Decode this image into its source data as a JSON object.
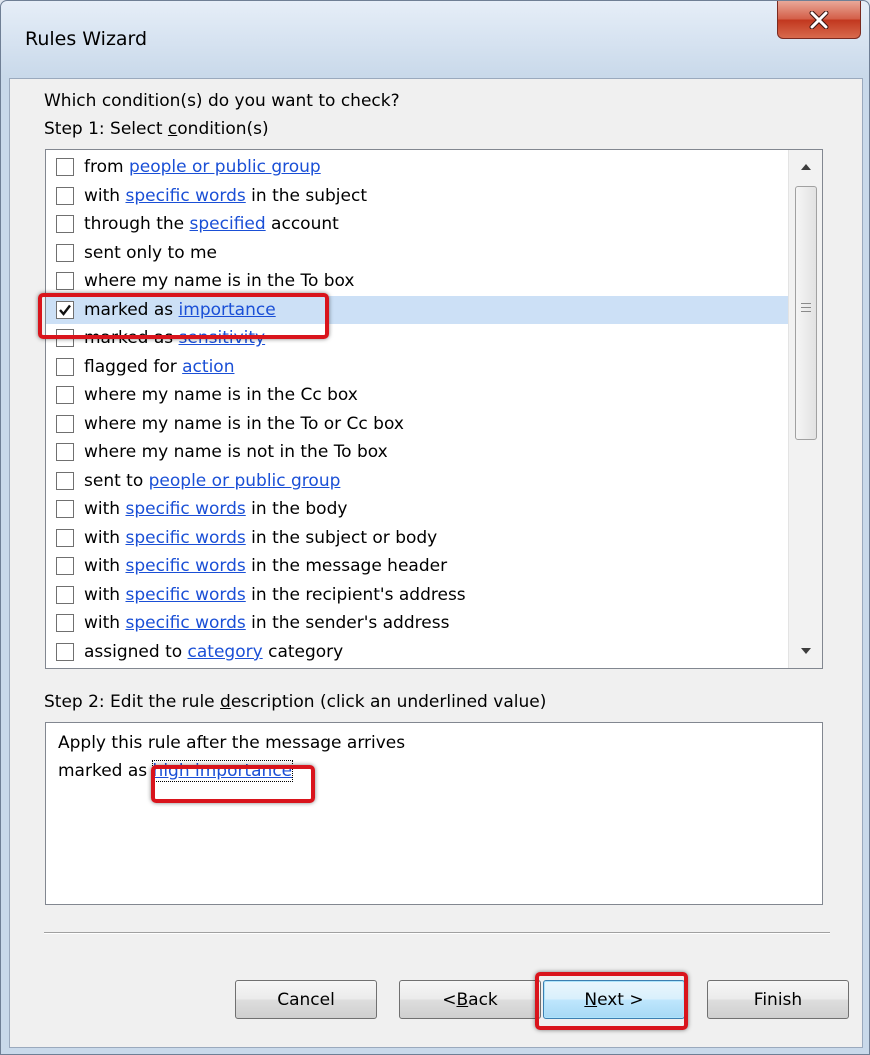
{
  "window": {
    "title": "Rules Wizard",
    "close_icon": "close-icon"
  },
  "step1": {
    "question": "Which condition(s) do you want to check?",
    "label": "Step 1: Select condition(s)",
    "conditions": [
      {
        "checked": false,
        "parts": [
          {
            "t": "from "
          },
          {
            "t": "people or public group",
            "link": true
          }
        ]
      },
      {
        "checked": false,
        "parts": [
          {
            "t": "with "
          },
          {
            "t": "specific words",
            "link": true
          },
          {
            "t": " in the subject"
          }
        ]
      },
      {
        "checked": false,
        "parts": [
          {
            "t": "through the "
          },
          {
            "t": "specified",
            "link": true
          },
          {
            "t": " account"
          }
        ]
      },
      {
        "checked": false,
        "parts": [
          {
            "t": "sent only to me"
          }
        ]
      },
      {
        "checked": false,
        "parts": [
          {
            "t": "where my name is in the To box"
          }
        ]
      },
      {
        "checked": true,
        "selected": true,
        "parts": [
          {
            "t": "marked as "
          },
          {
            "t": "importance",
            "link": true
          }
        ]
      },
      {
        "checked": false,
        "parts": [
          {
            "t": "marked as "
          },
          {
            "t": "sensitivity",
            "link": true
          }
        ]
      },
      {
        "checked": false,
        "parts": [
          {
            "t": "flagged for "
          },
          {
            "t": "action",
            "link": true
          }
        ]
      },
      {
        "checked": false,
        "parts": [
          {
            "t": "where my name is in the Cc box"
          }
        ]
      },
      {
        "checked": false,
        "parts": [
          {
            "t": "where my name is in the To or Cc box"
          }
        ]
      },
      {
        "checked": false,
        "parts": [
          {
            "t": "where my name is not in the To box"
          }
        ]
      },
      {
        "checked": false,
        "parts": [
          {
            "t": "sent to "
          },
          {
            "t": "people or public group",
            "link": true
          }
        ]
      },
      {
        "checked": false,
        "parts": [
          {
            "t": "with "
          },
          {
            "t": "specific words",
            "link": true
          },
          {
            "t": " in the body"
          }
        ]
      },
      {
        "checked": false,
        "parts": [
          {
            "t": "with "
          },
          {
            "t": "specific words",
            "link": true
          },
          {
            "t": " in the subject or body"
          }
        ]
      },
      {
        "checked": false,
        "parts": [
          {
            "t": "with "
          },
          {
            "t": "specific words",
            "link": true
          },
          {
            "t": " in the message header"
          }
        ]
      },
      {
        "checked": false,
        "parts": [
          {
            "t": "with "
          },
          {
            "t": "specific words",
            "link": true
          },
          {
            "t": " in the recipient's address"
          }
        ]
      },
      {
        "checked": false,
        "parts": [
          {
            "t": "with "
          },
          {
            "t": "specific words",
            "link": true
          },
          {
            "t": " in the sender's address"
          }
        ]
      },
      {
        "checked": false,
        "parts": [
          {
            "t": "assigned to "
          },
          {
            "t": "category",
            "link": true
          },
          {
            "t": " category"
          }
        ]
      }
    ]
  },
  "step2": {
    "label": "Step 2: Edit the rule description (click an underlined value)",
    "line1": "Apply this rule after the message arrives",
    "line2_prefix": "marked as ",
    "line2_link": "high importance"
  },
  "buttons": {
    "cancel": "Cancel",
    "back": "< Back",
    "next": "Next >",
    "finish": "Finish"
  },
  "colors": {
    "link": "#1a4fd6",
    "selection": "#cce0f6",
    "highlight": "#d9141c"
  }
}
